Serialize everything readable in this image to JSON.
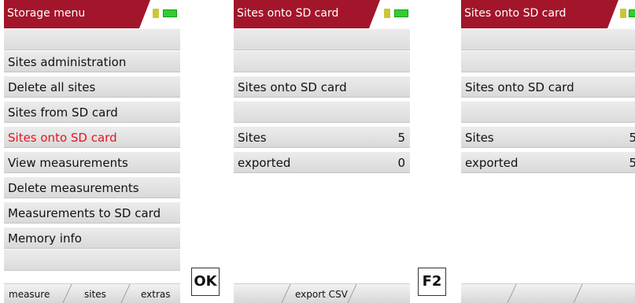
{
  "screen1": {
    "title": "Storage menu",
    "menu_items": [
      {
        "label": "Sites administration"
      },
      {
        "label": "Delete all sites"
      },
      {
        "label": "Sites from SD card"
      },
      {
        "label": "Sites onto SD card",
        "selected": true
      },
      {
        "label": "View measurements"
      },
      {
        "label": "Delete measurements"
      },
      {
        "label": "Measurements to SD card"
      },
      {
        "label": "Memory info"
      }
    ],
    "softkeys": [
      "measure",
      "sites",
      "extras"
    ]
  },
  "key1": "OK",
  "screen2": {
    "title": "Sites onto SD card",
    "heading": "Sites onto SD card",
    "rows": [
      {
        "label": "Sites",
        "value": "5"
      },
      {
        "label": "exported",
        "value": "0"
      }
    ],
    "softkeys": [
      "",
      "export CSV",
      ""
    ]
  },
  "key2": "F2",
  "screen3": {
    "title": "Sites onto SD card",
    "heading": "Sites onto SD card",
    "rows": [
      {
        "label": "Sites",
        "value": "5"
      },
      {
        "label": "exported",
        "value": "5"
      }
    ],
    "softkeys": [
      "",
      "",
      ""
    ]
  },
  "colors": {
    "titlebar": "#a3152a",
    "selected_text": "#e8141e",
    "battery": "#33cc33",
    "sd_card": "#c9c63a"
  },
  "icons": {
    "sd_card": "sd-card-icon",
    "battery": "battery-icon"
  }
}
